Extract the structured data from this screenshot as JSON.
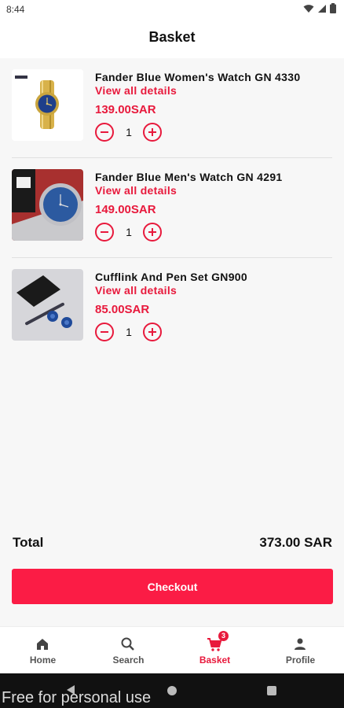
{
  "status_bar": {
    "time": "8:44"
  },
  "header": {
    "title": "Basket"
  },
  "items": [
    {
      "name": "Fander Blue Women's Watch GN 4330",
      "details_link": "View all details",
      "price": "139.00SAR",
      "quantity": "1",
      "image_icon": "gold-watch-icon"
    },
    {
      "name": "Fander Blue Men's Watch GN 4291",
      "details_link": "View all details",
      "price": "149.00SAR",
      "quantity": "1",
      "image_icon": "silver-watch-icon"
    },
    {
      "name": "Cufflink And Pen Set GN900",
      "details_link": "View all details",
      "price": "85.00SAR",
      "quantity": "1",
      "image_icon": "cufflink-pen-icon"
    }
  ],
  "summary": {
    "total_label": "Total",
    "total_value": "373.00 SAR"
  },
  "checkout": {
    "label": "Checkout"
  },
  "nav": {
    "items": [
      {
        "label": "Home",
        "icon": "home-icon"
      },
      {
        "label": "Search",
        "icon": "search-icon"
      },
      {
        "label": "Basket",
        "icon": "cart-icon",
        "badge": "3",
        "active": true
      },
      {
        "label": "Profile",
        "icon": "person-icon"
      }
    ]
  },
  "watermark": {
    "text": "Free for personal use"
  },
  "colors": {
    "accent": "#e8193c",
    "checkout": "#fb1c45",
    "background": "#f7f7f7"
  }
}
